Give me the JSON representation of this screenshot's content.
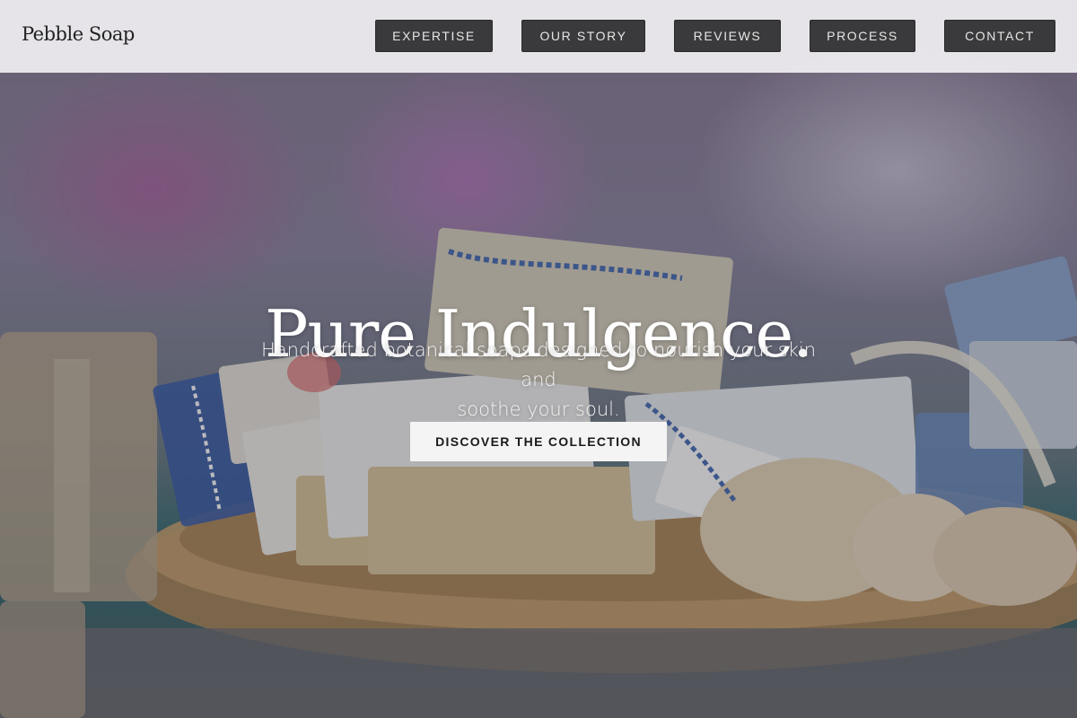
{
  "header": {
    "brand": "Pebble Soap",
    "nav": [
      {
        "label": "EXPERTISE"
      },
      {
        "label": "OUR STORY"
      },
      {
        "label": "REVIEWS"
      },
      {
        "label": "PROCESS"
      },
      {
        "label": "CONTACT"
      }
    ]
  },
  "hero": {
    "title": "Pure Indulgence.",
    "subtitle_line1": "Handcrafted botanical soaps designed to nourish your skin and",
    "subtitle_line2": "soothe your soul.",
    "cta_label": "DISCOVER THE COLLECTION"
  },
  "colors": {
    "header_bg": "#f0eef2",
    "nav_button_bg": "#3a3a3c",
    "cta_bg": "#f4f4f4",
    "title_text": "#ffffff"
  }
}
